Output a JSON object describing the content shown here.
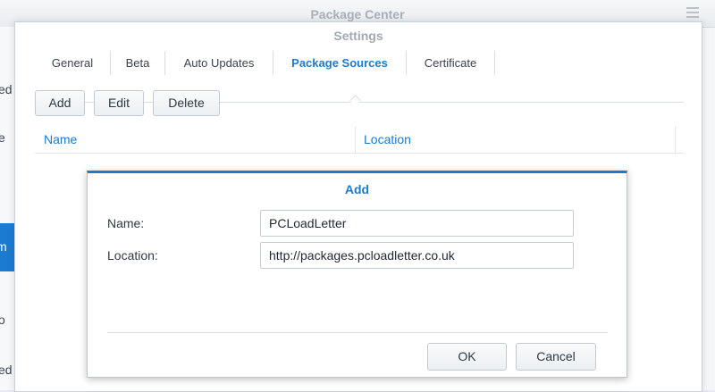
{
  "background": {
    "title": "Package Center",
    "sidebar_fragments": [
      "ed",
      "e",
      "m",
      "o",
      "ed"
    ]
  },
  "settings": {
    "title": "Settings",
    "tabs": [
      {
        "label": "General",
        "active": false
      },
      {
        "label": "Beta",
        "active": false
      },
      {
        "label": "Auto Updates",
        "active": false
      },
      {
        "label": "Package Sources",
        "active": true
      },
      {
        "label": "Certificate",
        "active": false
      }
    ],
    "toolbar": {
      "add_label": "Add",
      "edit_label": "Edit",
      "delete_label": "Delete"
    },
    "grid": {
      "columns": [
        "Name",
        "Location"
      ]
    }
  },
  "dialog": {
    "title": "Add",
    "name_label": "Name:",
    "name_value": "PCLoadLetter",
    "location_label": "Location:",
    "location_value": "http://packages.pcloadletter.co.uk",
    "ok_label": "OK",
    "cancel_label": "Cancel"
  },
  "colors": {
    "accent": "#1b7bd1",
    "background": "#e7ebef"
  }
}
